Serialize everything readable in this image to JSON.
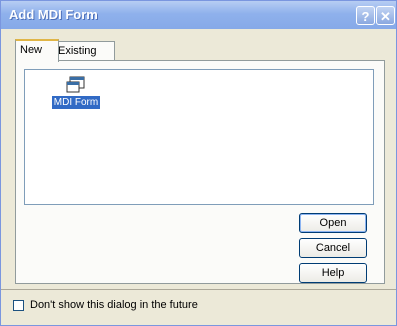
{
  "window": {
    "title": "Add MDI Form",
    "help_glyph": "?",
    "close_glyph": "✕"
  },
  "tabs": [
    {
      "label": "New",
      "selected": true
    },
    {
      "label": "Existing",
      "selected": false
    }
  ],
  "listview": {
    "items": [
      {
        "label": "MDI Form",
        "icon": "mdi-form-icon",
        "selected": true
      }
    ]
  },
  "buttons": {
    "open": "Open",
    "cancel": "Cancel",
    "help": "Help"
  },
  "footer": {
    "checkbox_label": "Don't show this dialog in the future",
    "checked": false
  },
  "colors": {
    "selection": "#316ac5",
    "titlebar": "#8fb1ec",
    "face": "#ece9d8"
  }
}
